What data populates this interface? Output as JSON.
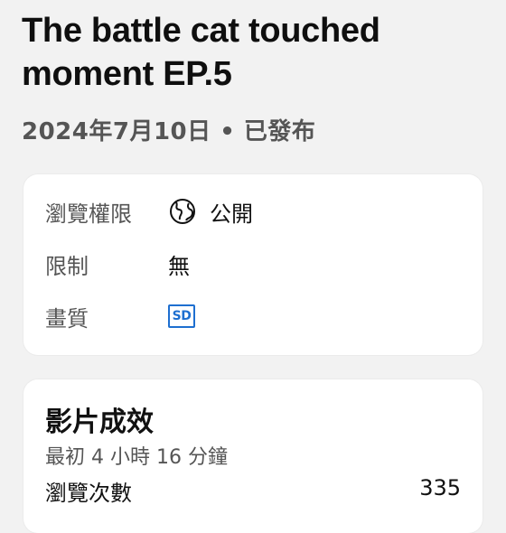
{
  "video": {
    "title": "The battle cat touched moment EP.5",
    "meta": "2024年7月10日 • 已發布"
  },
  "details": {
    "visibility": {
      "label": "瀏覽權限",
      "value": "公開",
      "icon": "globe-icon"
    },
    "restrictions": {
      "label": "限制",
      "value": "無"
    },
    "quality": {
      "label": "畫質",
      "value": "SD",
      "icon": "sd-badge-icon"
    }
  },
  "performance": {
    "title": "影片成效",
    "subtitle": "最初 4 小時 16 分鐘",
    "views_label": "瀏覽次數",
    "views_value": "335"
  },
  "colors": {
    "background": "#f2f2f2",
    "card": "#ffffff",
    "sd_badge": "#1e6fd0",
    "secondary_text": "#555555"
  }
}
